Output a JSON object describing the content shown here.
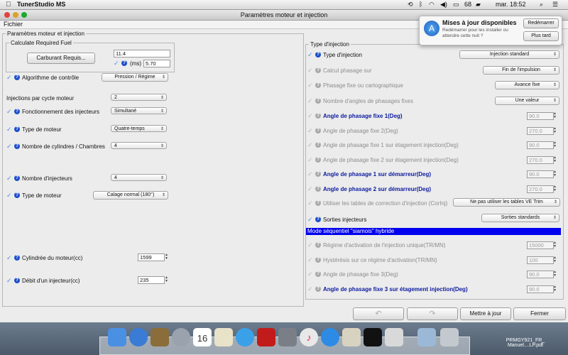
{
  "menubar": {
    "app_name": "TunerStudio MS",
    "battery": "68",
    "clock": "mar. 18:52"
  },
  "window": {
    "title": "Paramètres moteur et injection",
    "file_menu": "Fichier"
  },
  "left": {
    "group_title": "Paramètres moteur et injection",
    "req_fuel": {
      "title": "Calculate Required Fuel",
      "button": "Carburant Requis...",
      "value": "11.4",
      "ms_label": "(ms)",
      "ms_value": "5.70"
    },
    "rows": {
      "algo_label": "Algorithme de contrôle",
      "algo_value": "Pression / Régime",
      "inj_cycle_label": "Injections par cycle moteur",
      "inj_cycle_value": "2",
      "inj_mode_label": "Fonctionnement des injecteurs",
      "inj_mode_value": "Simultané",
      "engine_type_label": "Type de moteur",
      "engine_type_value": "Quatre-temps",
      "cyl_label": "Nombre de cylindres / Chambres",
      "cyl_value": "4",
      "nb_inj_label": "Nombre d'injecteurs",
      "nb_inj_value": "4",
      "engine_type2_label": "Type de moteur",
      "engine_type2_value": "Calage normal (180°)",
      "displacement_label": "Cylindrée du moteur(cc)",
      "displacement_value": "1599",
      "flow_label": "Débit d'un injecteur(cc)",
      "flow_value": "235"
    }
  },
  "right": {
    "group_title": "Type d'injection",
    "inj_type_label": "Type d'injection",
    "inj_type_value": "Injection standard",
    "phase_calc_label": "Calcul phasage sur",
    "phase_calc_value": "Fin de l'impulsion",
    "phase_map_label": "Phasage fixe ou cartographique",
    "phase_map_value": "Avance fixe",
    "nb_angles_label": "Nombre d'angles de phasages fixes",
    "nb_angles_value": "Une valeur",
    "angle1_label": "Angle de phasage fixe 1(Deg)",
    "angle1_value": "90.0",
    "angle2_label": "Angle de phasage fixe 2(Deg)",
    "angle2_value": "270.0",
    "angle1_stage_label": "Angle de phasage fixe 1 sur étagement injection(Deg)",
    "angle1_stage_value": "90.0",
    "angle2_stage_label": "Angle de phasage fixe 2 sur étagement injection(Deg)",
    "angle2_stage_value": "270.0",
    "angle1_start_label": "Angle de phasage 1 sur démarreur(Deg)",
    "angle1_start_value": "90.0",
    "angle2_start_label": "Angle de phasage 2 sur démarreur(Deg)",
    "angle2_start_value": "270.0",
    "corr_label": "Utiliser les tables de correction d'injection (CorInj)",
    "corr_value": "Ne pas utiliser les tables VE Trim",
    "outputs_label": "Sorties injecteurs",
    "outputs_value": "Sorties standards",
    "siamese_banner": "Mode séquentiel \"siamois\" hybride",
    "rpm_single_label": "Régime d'activation de l'injection unique(TR/MN)",
    "rpm_single_value": "15000",
    "hyst_label": "Hystérésis sur ce régime d'activation(TR/MN)",
    "hyst_value": "100",
    "angle3_label": "Angle de phasage fixe 3(Deg)",
    "angle3_value": "90.0",
    "angle3_stage_label": "Angle de phasage fixe 3 sur étagement injection(Deg)",
    "angle3_stage_value": "90.0"
  },
  "buttons": {
    "update": "Mettre à jour",
    "close": "Fermer"
  },
  "notification": {
    "title": "Mises à jour disponibles",
    "body": "Redémarrer pour les installer ou attendre cette nuit ?",
    "restart": "Redémarrer",
    "later": "Plus tard"
  },
  "desktop": {
    "file_label": "PRMGY921_FR_ Manuel....LP.pdf",
    "calendar_day": "16"
  },
  "colors": {
    "accent_blue": "#1c4fc9",
    "banner_blue": "#0000ee",
    "bold_label_blue": "#0b1a9e"
  }
}
